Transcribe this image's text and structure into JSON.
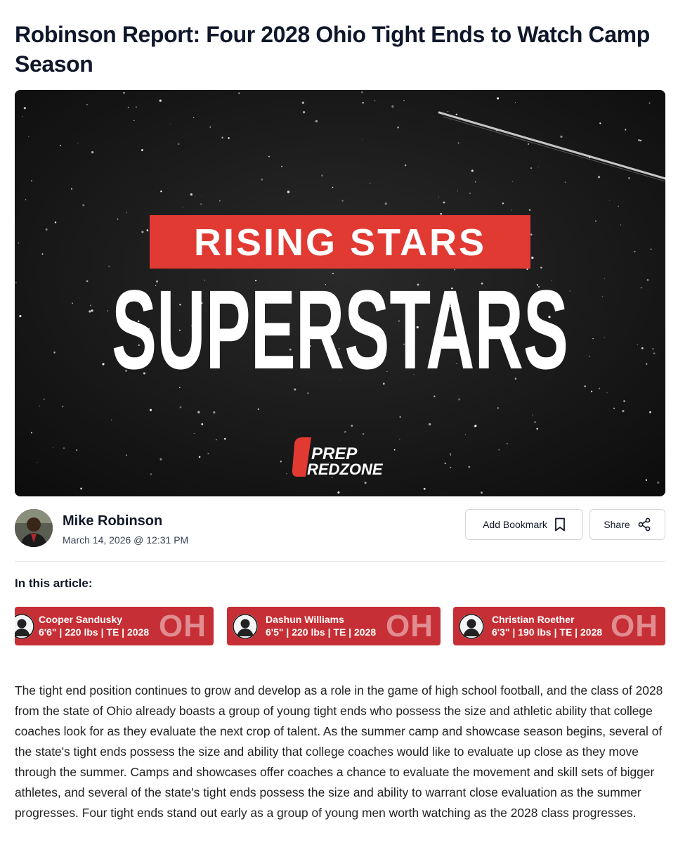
{
  "article": {
    "title": "Robinson Report: Four 2028 Ohio Tight Ends to Watch Camp Season",
    "hero": {
      "banner_text": "RISING STARS",
      "headline_text": "SUPERSTARS",
      "logo_line1": "PREP",
      "logo_line2": "REDZONE",
      "accent_color": "#e03a33"
    },
    "author": {
      "name": "Mike Robinson",
      "date": "March 14, 2026 @ 12:31 PM"
    },
    "actions": {
      "bookmark_label": "Add Bookmark",
      "share_label": "Share"
    },
    "in_article_label": "In this article:",
    "players": [
      {
        "name": "Cooper Sandusky",
        "info": "6'6\" | 220 lbs | TE | 2028",
        "state": "OH"
      },
      {
        "name": "Dashun Williams",
        "info": "6'5\" | 220 lbs | TE | 2028",
        "state": "OH"
      },
      {
        "name": "Christian Roether",
        "info": "6'3\" | 190 lbs | TE | 2028",
        "state": "OH"
      }
    ],
    "body": "The tight end position continues to grow and develop as a role in the game of high school football, and the class of 2028 from the state of Ohio already boasts a group of young tight ends who possess the size and athletic ability that college coaches look for as they evaluate the next crop of talent. As the summer camp and showcase season begins, several of the state's tight ends possess the size and ability that college coaches would like to evaluate up close as they move through the summer. Camps and showcases offer coaches a chance to evaluate the movement and skill sets of bigger athletes, and several of the state's tight ends possess the size and ability to warrant close evaluation as the summer progresses. Four tight ends stand out early as a group of young men worth watching as the 2028 class progresses."
  },
  "colors": {
    "player_card": "#c62f35",
    "title_text": "#0f172a"
  }
}
